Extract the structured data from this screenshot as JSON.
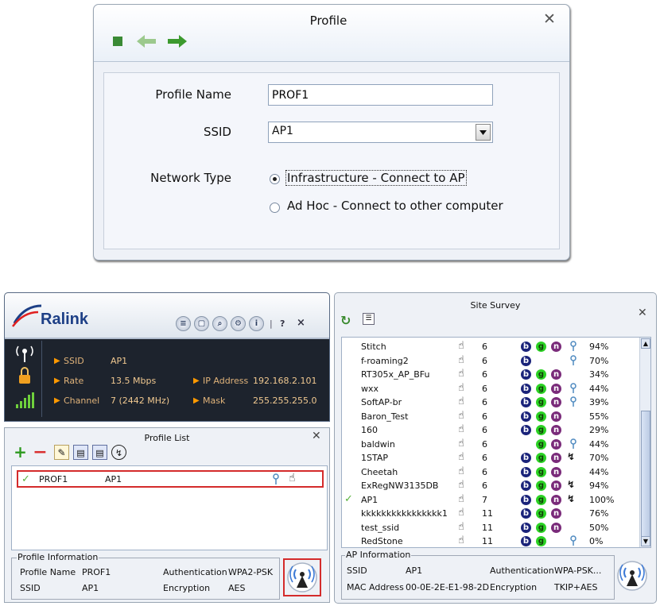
{
  "profile_dialog": {
    "title": "Profile",
    "profile_name_label": "Profile Name",
    "profile_name_value": "PROF1",
    "ssid_label": "SSID",
    "ssid_value": "AP1",
    "network_type_label": "Network Type",
    "options": [
      "Infrastructure - Connect to AP",
      "Ad Hoc - Connect to other computer"
    ],
    "selected_option": 0
  },
  "main_window": {
    "logo": "Ralink",
    "toolbar_extras": [
      "?",
      "×"
    ],
    "ssid_label": "SSID",
    "ssid_value": "AP1",
    "rate_label": "Rate",
    "rate_value": "13.5 Mbps",
    "channel_label": "Channel",
    "channel_value": "7 (2442 MHz)",
    "ip_label": "IP Address",
    "ip_value": "192.168.2.101",
    "mask_label": "Mask",
    "mask_value": "255.255.255.0"
  },
  "profile_list": {
    "title": "Profile List",
    "rows": [
      {
        "profile": "PROF1",
        "ssid": "AP1"
      }
    ],
    "info": {
      "legend": "Profile Information",
      "profile_name_label": "Profile Name",
      "profile_name_value": "PROF1",
      "ssid_label": "SSID",
      "ssid_value": "AP1",
      "auth_label": "Authentication",
      "auth_value": "WPA2-PSK",
      "enc_label": "Encryption",
      "enc_value": "AES"
    }
  },
  "site_survey": {
    "title": "Site Survey",
    "rows": [
      {
        "ssid": "Stitch",
        "channel": "6",
        "b": true,
        "g": true,
        "n": true,
        "key": true,
        "wps": false,
        "signal": "94%",
        "connected": false
      },
      {
        "ssid": "f-roaming2",
        "channel": "6",
        "b": true,
        "g": false,
        "n": false,
        "key": true,
        "wps": false,
        "signal": "70%",
        "connected": false
      },
      {
        "ssid": "RT305x_AP_BFu",
        "channel": "6",
        "b": true,
        "g": true,
        "n": true,
        "key": false,
        "wps": false,
        "signal": "34%",
        "connected": false
      },
      {
        "ssid": "wxx",
        "channel": "6",
        "b": true,
        "g": true,
        "n": true,
        "key": true,
        "wps": false,
        "signal": "44%",
        "connected": false
      },
      {
        "ssid": "SoftAP-br",
        "channel": "6",
        "b": true,
        "g": true,
        "n": true,
        "key": true,
        "wps": false,
        "signal": "39%",
        "connected": false
      },
      {
        "ssid": "Baron_Test",
        "channel": "6",
        "b": true,
        "g": true,
        "n": true,
        "key": false,
        "wps": false,
        "signal": "55%",
        "connected": false
      },
      {
        "ssid": "160",
        "channel": "6",
        "b": true,
        "g": true,
        "n": true,
        "key": false,
        "wps": false,
        "signal": "29%",
        "connected": false
      },
      {
        "ssid": "baldwin",
        "channel": "6",
        "b": false,
        "g": true,
        "n": true,
        "key": true,
        "wps": false,
        "signal": "44%",
        "connected": false
      },
      {
        "ssid": "1STAP",
        "channel": "6",
        "b": true,
        "g": true,
        "n": true,
        "key": false,
        "wps": true,
        "signal": "70%",
        "connected": false
      },
      {
        "ssid": "Cheetah",
        "channel": "6",
        "b": true,
        "g": true,
        "n": true,
        "key": false,
        "wps": false,
        "signal": "44%",
        "connected": false
      },
      {
        "ssid": "ExRegNW3135DB",
        "channel": "6",
        "b": true,
        "g": true,
        "n": true,
        "key": false,
        "wps": true,
        "signal": "94%",
        "connected": false
      },
      {
        "ssid": "AP1",
        "channel": "7",
        "b": true,
        "g": true,
        "n": true,
        "key": false,
        "wps": true,
        "signal": "100%",
        "connected": true
      },
      {
        "ssid": "kkkkkkkkkkkkkkkk1...",
        "channel": "11",
        "b": true,
        "g": true,
        "n": true,
        "key": false,
        "wps": false,
        "signal": "76%",
        "connected": false
      },
      {
        "ssid": "test_ssid",
        "channel": "11",
        "b": true,
        "g": true,
        "n": true,
        "key": false,
        "wps": false,
        "signal": "50%",
        "connected": false
      },
      {
        "ssid": "RedStone",
        "channel": "11",
        "b": true,
        "g": true,
        "n": false,
        "key": true,
        "wps": false,
        "signal": "0%",
        "connected": false
      }
    ],
    "info": {
      "legend": "AP Information",
      "ssid_label": "SSID",
      "ssid_value": "AP1",
      "mac_label": "MAC Address",
      "mac_value": "00-0E-2E-E1-98-2D",
      "auth_label": "Authentication",
      "auth_value": "WPA-PSK...",
      "enc_label": "Encryption",
      "enc_value": "TKIP+AES"
    }
  }
}
